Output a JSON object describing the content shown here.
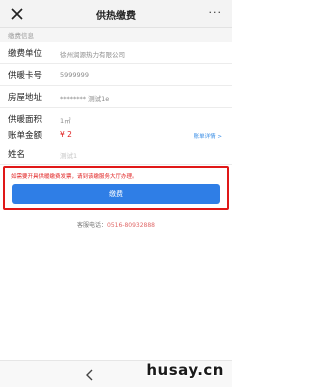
{
  "header": {
    "title": "供热缴费",
    "close_icon": "close-icon",
    "more_icon": "more-icon",
    "more_glyph": "···"
  },
  "section": {
    "title": "缴费信息"
  },
  "fields": {
    "unit": {
      "label": "缴费单位",
      "value": "徐州润源热力有限公司"
    },
    "card": {
      "label": "供暖卡号",
      "value": "5999999"
    },
    "address": {
      "label": "房屋地址",
      "value": "******** 测试1e"
    },
    "area": {
      "label": "供暖面积",
      "value": "1㎡"
    },
    "amount": {
      "label": "账单金额",
      "value": "¥ 2",
      "link": "账单详情 >"
    },
    "name": {
      "label": "姓名",
      "placeholder": "测试1"
    }
  },
  "notice": {
    "text": "如需要开具供暖缴费发票，请到该缴服务大厅办理。"
  },
  "pay_button": {
    "label": "缴费"
  },
  "service": {
    "label": "客服电话：",
    "phone": "0516-80932888"
  },
  "footer": {
    "back_icon": "back-icon"
  },
  "watermark": {
    "text": "husay.cn"
  },
  "colors": {
    "accent": "#2f7ee6",
    "alert": "#e02020",
    "link": "#3a8ee6"
  }
}
